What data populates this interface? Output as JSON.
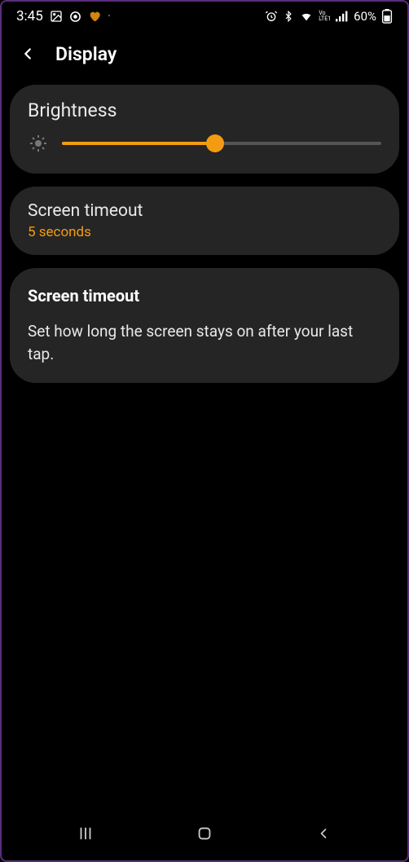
{
  "status": {
    "time": "3:45",
    "battery_percent": "60%"
  },
  "header": {
    "title": "Display"
  },
  "brightness": {
    "title": "Brightness",
    "level_percent": 48
  },
  "screen_timeout": {
    "title": "Screen timeout",
    "value": "5 seconds"
  },
  "popup": {
    "title": "Screen timeout",
    "description": "Set how long the screen stays on after your last tap."
  },
  "colors": {
    "accent": "#f39c12"
  }
}
